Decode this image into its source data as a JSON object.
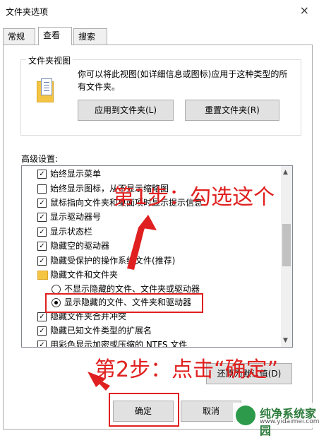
{
  "window": {
    "title": "文件夹选项",
    "close_glyph": "×"
  },
  "tabs": [
    {
      "label": "常规"
    },
    {
      "label": "查看"
    },
    {
      "label": "搜索"
    }
  ],
  "folder_views": {
    "group_label": "文件夹视图",
    "description": "你可以将此视图(如详细信息或图标)应用于这种类型的所有文件夹。",
    "apply_button": "应用到文件夹(L)",
    "reset_button": "重置文件夹(R)"
  },
  "advanced": {
    "label": "高级设置:",
    "items": [
      {
        "type": "checkbox",
        "checked": true,
        "label": "始终显示菜单"
      },
      {
        "type": "checkbox",
        "checked": false,
        "label": "始终显示图标，从不显示缩略图"
      },
      {
        "type": "checkbox",
        "checked": true,
        "label": "鼠标指向文件夹和桌面项时显示提示信息"
      },
      {
        "type": "checkbox",
        "checked": true,
        "label": "显示驱动器号"
      },
      {
        "type": "checkbox",
        "checked": true,
        "label": "显示状态栏"
      },
      {
        "type": "checkbox",
        "checked": true,
        "label": "隐藏空的驱动器"
      },
      {
        "type": "checkbox",
        "checked": true,
        "label": "隐藏受保护的操作系统文件(推荐)"
      },
      {
        "type": "folder",
        "label": "隐藏文件和文件夹"
      },
      {
        "type": "radio",
        "checked": false,
        "label": "不显示隐藏的文件、文件夹或驱动器"
      },
      {
        "type": "radio",
        "checked": true,
        "label": "显示隐藏的文件、文件夹和驱动器"
      },
      {
        "type": "checkbox",
        "checked": true,
        "label": "隐藏文件夹合并冲突"
      },
      {
        "type": "checkbox",
        "checked": true,
        "label": "隐藏已知文件类型的扩展名"
      },
      {
        "type": "checkbox",
        "checked": true,
        "label": "用彩色显示加密或压缩的 NTFS 文件"
      }
    ],
    "restore_button": "还原为默认值(D)"
  },
  "footer": {
    "ok_button": "确定",
    "cancel_button": "取消"
  },
  "annotations": {
    "step1": "第1步：勾选这个",
    "step2": "第2步：点击“确定”",
    "accent_color": "#e02020"
  },
  "watermark": {
    "name": "纯净系统家园",
    "url": "www.yidaimei.com"
  }
}
